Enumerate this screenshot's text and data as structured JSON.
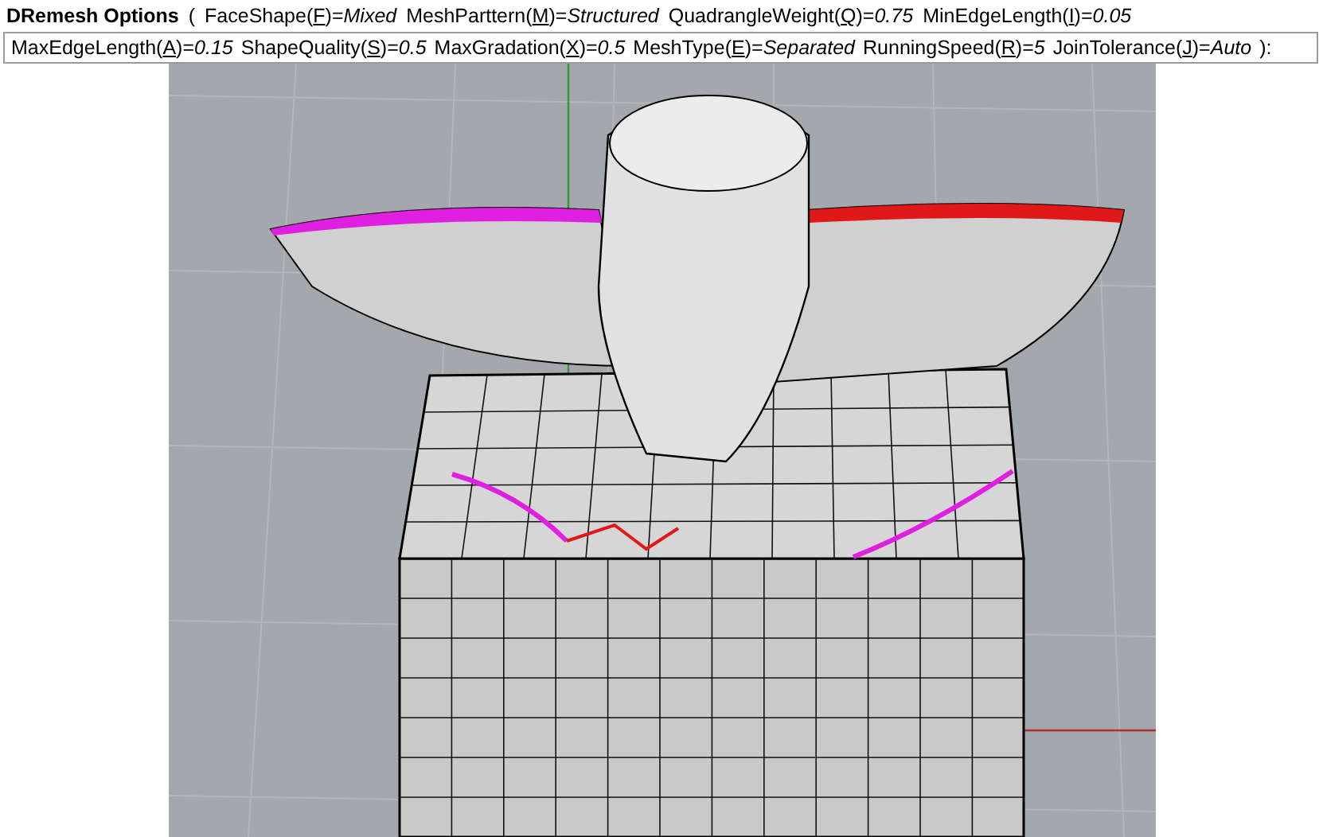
{
  "command_prompt": {
    "title": "DRemesh Options",
    "open": "(",
    "close": "):",
    "row_1": [
      {
        "label": "FaceShape(",
        "key": "F",
        "after": ")=",
        "value": "Mixed"
      },
      {
        "label": "MeshParttern(",
        "key": "M",
        "after": ")=",
        "value": "Structured"
      },
      {
        "label": "QuadrangleWeight(",
        "key": "Q",
        "after": ")=",
        "value": "0.75"
      },
      {
        "label": "MinEdgeLength(",
        "key": "I",
        "after": ")=",
        "value": "0.05"
      }
    ],
    "row_2": [
      {
        "label": "MaxEdgeLength(",
        "key": "A",
        "after": ")=",
        "value": "0.15"
      },
      {
        "label": "ShapeQuality(",
        "key": "S",
        "after": ")=",
        "value": "0.5"
      },
      {
        "label": "MaxGradation(",
        "key": "X",
        "after": ")=",
        "value": "0.5"
      },
      {
        "label": "MeshType(",
        "key": "E",
        "after": ")=",
        "value": "Separated"
      },
      {
        "label": "RunningSpeed(",
        "key": "R",
        "after": ")=",
        "value": "5"
      },
      {
        "label": "JoinTolerance(",
        "key": "J",
        "after": ")=",
        "value": "Auto"
      }
    ]
  }
}
